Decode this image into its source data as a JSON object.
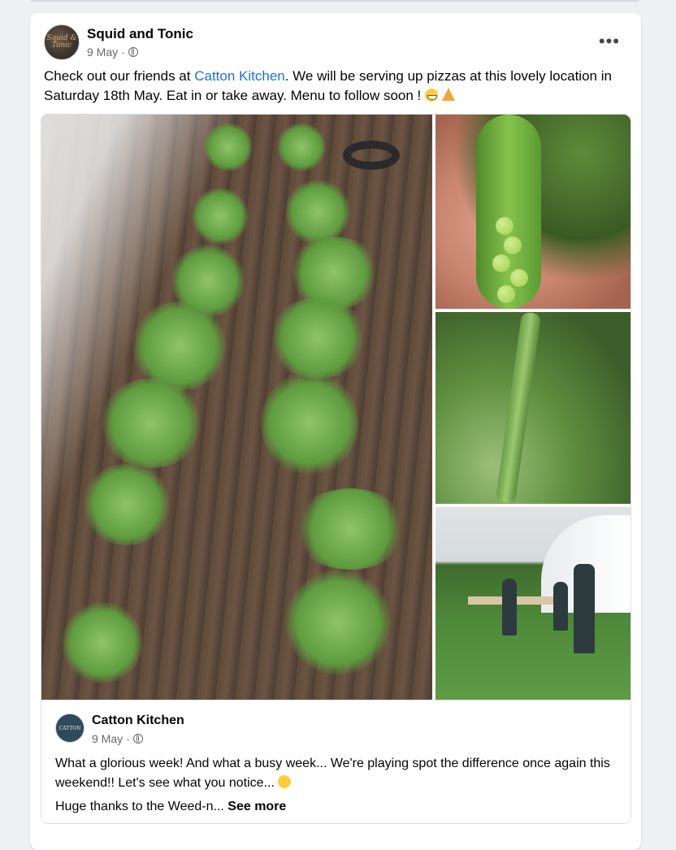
{
  "post": {
    "author": "Squid and Tonic",
    "avatar_text": "Squid & Tonic",
    "date": "9 May",
    "separator": "·",
    "text_before_link": "Check out  our friends at ",
    "link_text": "Catton Kitchen",
    "text_after_link": ". We will be serving up pizzas at this lovely location in Saturday 18th May. Eat in or take away. Menu to follow soon ! ",
    "more_icon": "more-horizontal-icon"
  },
  "shared_post": {
    "author": "Catton Kitchen",
    "avatar_text": "CATTON",
    "date": "9 May",
    "separator": "·",
    "text_line1": "What a glorious week! And what a busy week... We're playing spot the difference once again this weekend!!  Let's see what you notice... ",
    "text_line2": "Huge thanks to the Weed-n... ",
    "see_more": "See more"
  },
  "colors": {
    "link": "#216fdb",
    "meta": "#65676b",
    "background": "#eef0f3"
  }
}
